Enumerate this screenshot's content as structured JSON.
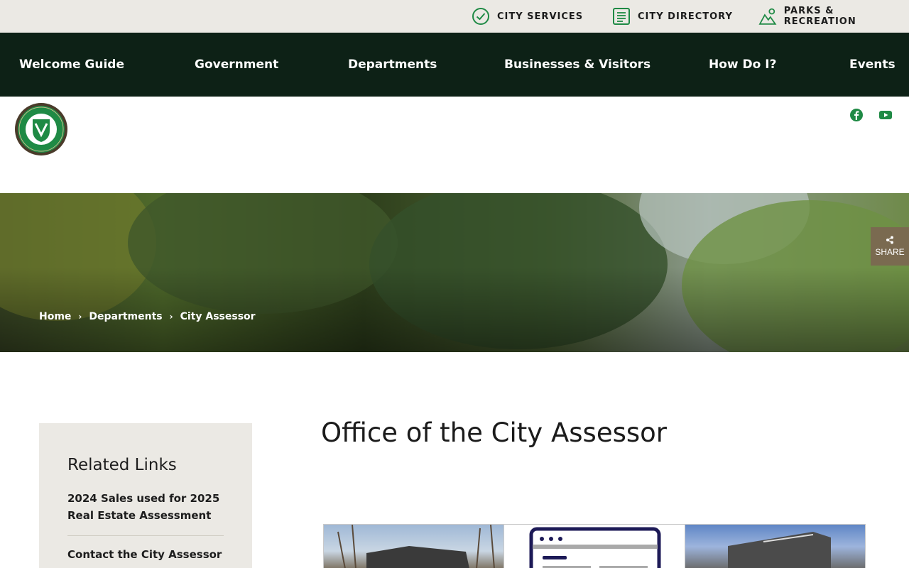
{
  "utility_bar": {
    "links": [
      {
        "label": "CITY SERVICES",
        "icon": "check-circle-icon"
      },
      {
        "label": "CITY DIRECTORY",
        "icon": "list-document-icon"
      },
      {
        "label": "PARKS & RECREATION",
        "icon": "mountain-icon"
      }
    ]
  },
  "main_nav": {
    "items": [
      "Welcome Guide",
      "Government",
      "Departments",
      "Businesses & Visitors",
      "How Do I?",
      "Events"
    ]
  },
  "header": {
    "logo_icon": "city-seal-logo",
    "social": [
      {
        "icon": "facebook-icon"
      },
      {
        "icon": "youtube-icon"
      }
    ]
  },
  "hero": {
    "breadcrumb": [
      "Home",
      "Departments",
      "City Assessor"
    ],
    "share_label": "SHARE"
  },
  "sidebar": {
    "title": "Related Links",
    "links": [
      "2024 Sales used for 2025 Real Estate Assessment",
      "Contact the City Assessor"
    ]
  },
  "main": {
    "title": "Office of the City Assessor",
    "tiles": [
      {
        "icon": "house-photo"
      },
      {
        "icon": "web-form-icon"
      },
      {
        "icon": "city-hall-photo"
      }
    ]
  },
  "colors": {
    "nav_bg": "#0d2116",
    "utility_bg": "#ebe9e4",
    "accent_green": "#1f8a45",
    "share_bg": "#7a6a50"
  }
}
